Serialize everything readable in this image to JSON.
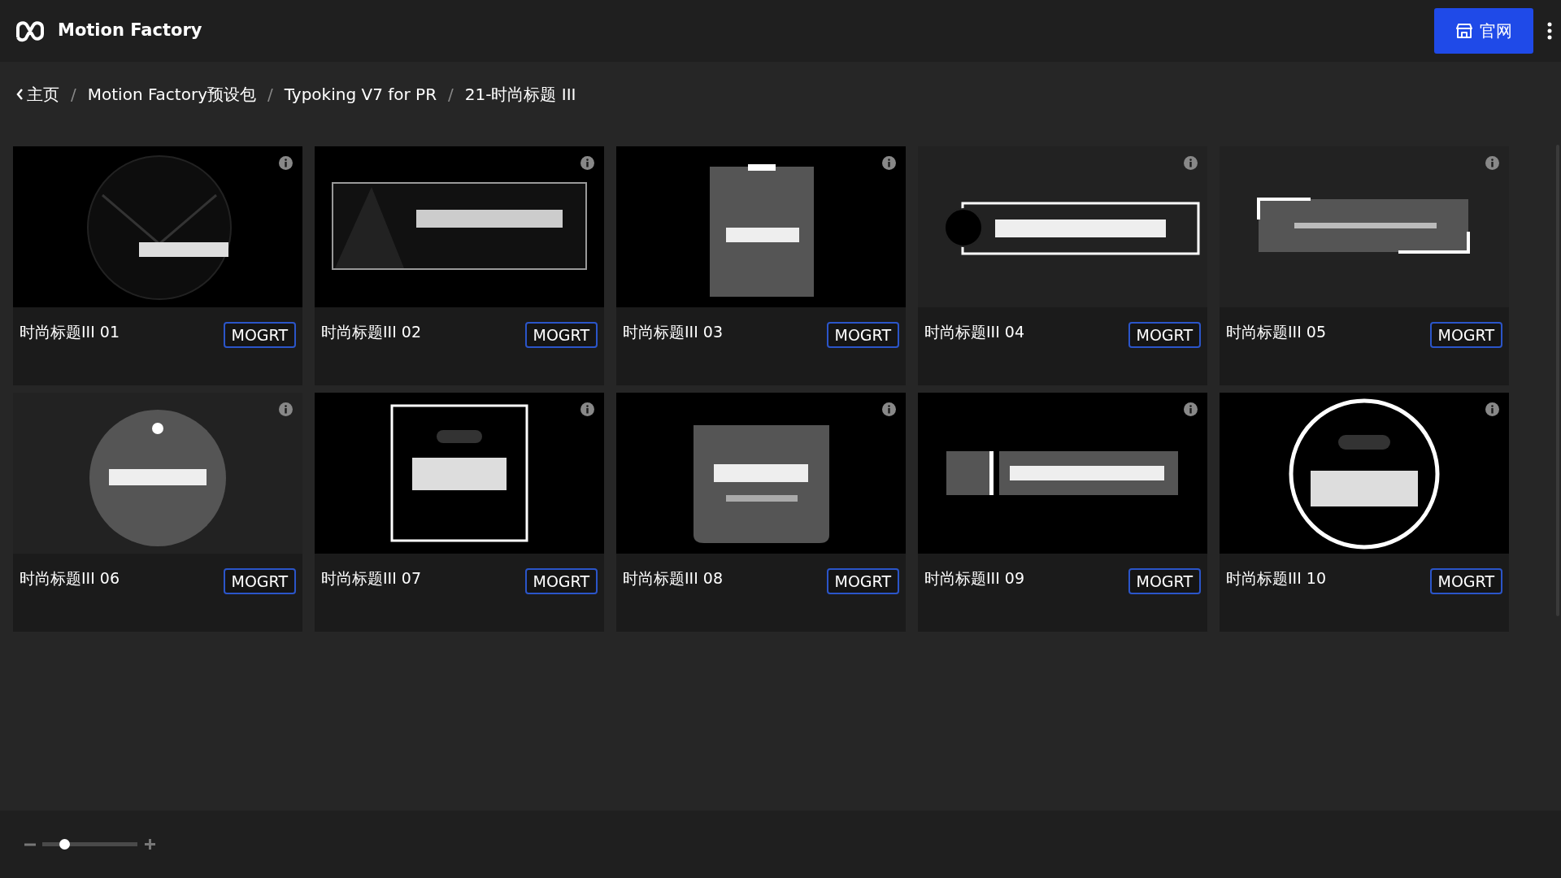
{
  "app": {
    "title": "Motion Factory",
    "site_button": "官网"
  },
  "breadcrumb": [
    "主页",
    "Motion Factory预设包",
    "Typoking V7 for PR",
    "21-时尚标题 III"
  ],
  "breadcrumb_separator": "/",
  "items": [
    {
      "title": "时尚标题III 01",
      "button": "MOGRT"
    },
    {
      "title": "时尚标题III 02",
      "button": "MOGRT"
    },
    {
      "title": "时尚标题III 03",
      "button": "MOGRT"
    },
    {
      "title": "时尚标题III 04",
      "button": "MOGRT"
    },
    {
      "title": "时尚标题III 05",
      "button": "MOGRT"
    },
    {
      "title": "时尚标题III 06",
      "button": "MOGRT"
    },
    {
      "title": "时尚标题III 07",
      "button": "MOGRT"
    },
    {
      "title": "时尚标题III 08",
      "button": "MOGRT"
    },
    {
      "title": "时尚标题III 09",
      "button": "MOGRT"
    },
    {
      "title": "时尚标题III 10",
      "button": "MOGRT"
    }
  ],
  "zoom": {
    "level": 0.23
  }
}
